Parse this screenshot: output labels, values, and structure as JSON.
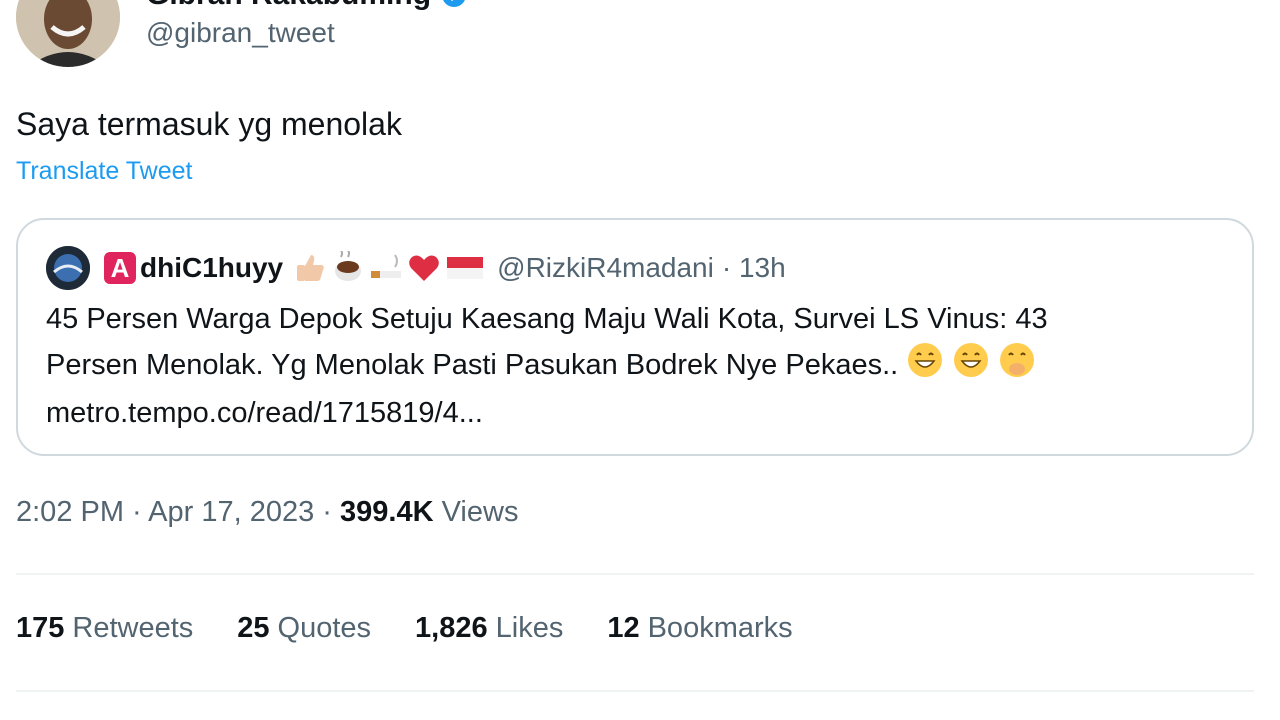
{
  "author": {
    "display_name": "Gibran Rakabuming",
    "handle": "@gibran_tweet",
    "verified_icon": "verified-badge-icon"
  },
  "tweet": {
    "text": "Saya termasuk yg menolak",
    "translate_label": "Translate Tweet"
  },
  "quoted_tweet": {
    "badge_letter": "A",
    "display_name": "dhiC1huyy",
    "handle": "@RizkiR4madani",
    "time": "· 13h",
    "text_line1": "45 Persen Warga Depok Setuju Kaesang Maju Wali Kota, Survei LS Vinus: 43",
    "text_line2": "Persen Menolak. Yg Menolak Pasti Pasukan Bodrek Nye Pekaes..",
    "link": "metro.tempo.co/read/1715819/4..."
  },
  "meta": {
    "time": "2:02 PM",
    "separator": " · ",
    "date": "Apr 17, 2023",
    "separator2": " · ",
    "views_count": "399.4K",
    "views_label": "Views"
  },
  "stats": {
    "retweets_count": "175",
    "retweets_label": "Retweets",
    "quotes_count": "25",
    "quotes_label": "Quotes",
    "likes_count": "1,826",
    "likes_label": "Likes",
    "bookmarks_count": "12",
    "bookmarks_label": "Bookmarks"
  },
  "colors": {
    "link_blue": "#1d9bf0",
    "secondary_text": "#536471",
    "border": "#cfd9de"
  }
}
